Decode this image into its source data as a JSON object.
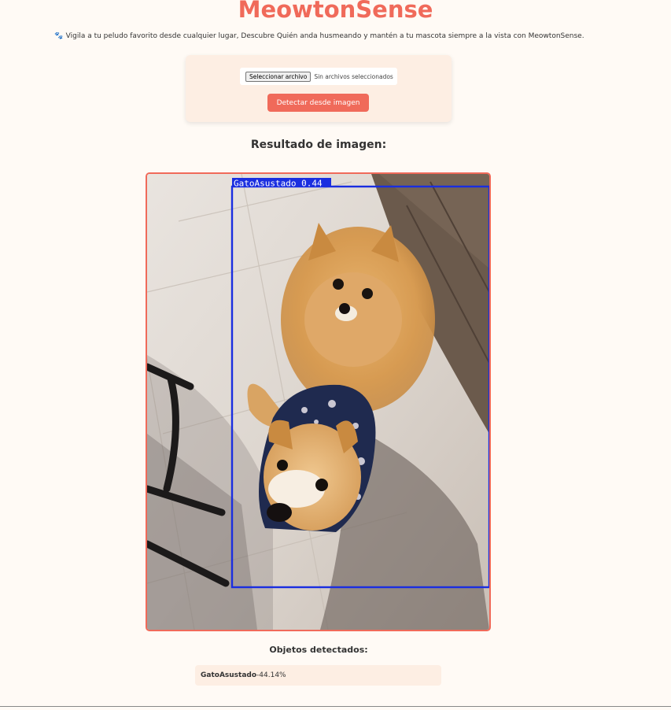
{
  "header": {
    "title": "MeowtonSense",
    "paw_icon": "🐾",
    "subtitle": "Vigila a tu peludo favorito desde cualquier lugar, Descubre Quién anda husmeando y mantén a tu mascota siempre a la vista con MeowtonSense."
  },
  "upload": {
    "file_button_label": "Seleccionar archivo",
    "file_status": "Sin archivos seleccionados",
    "detect_button_label": "Detectar desde imagen"
  },
  "result": {
    "heading": "Resultado de imagen:",
    "bbox_label": "GatoAsustado 0.44",
    "bbox_color": "#1a2ee0"
  },
  "detections": {
    "heading": "Objetos detectados:",
    "items": [
      {
        "name": "GatoAsustado",
        "separator": " - ",
        "confidence": "44.14%"
      }
    ]
  },
  "colors": {
    "accent": "#f06a5a",
    "background": "#fffaf5",
    "card": "#fdeee3"
  }
}
